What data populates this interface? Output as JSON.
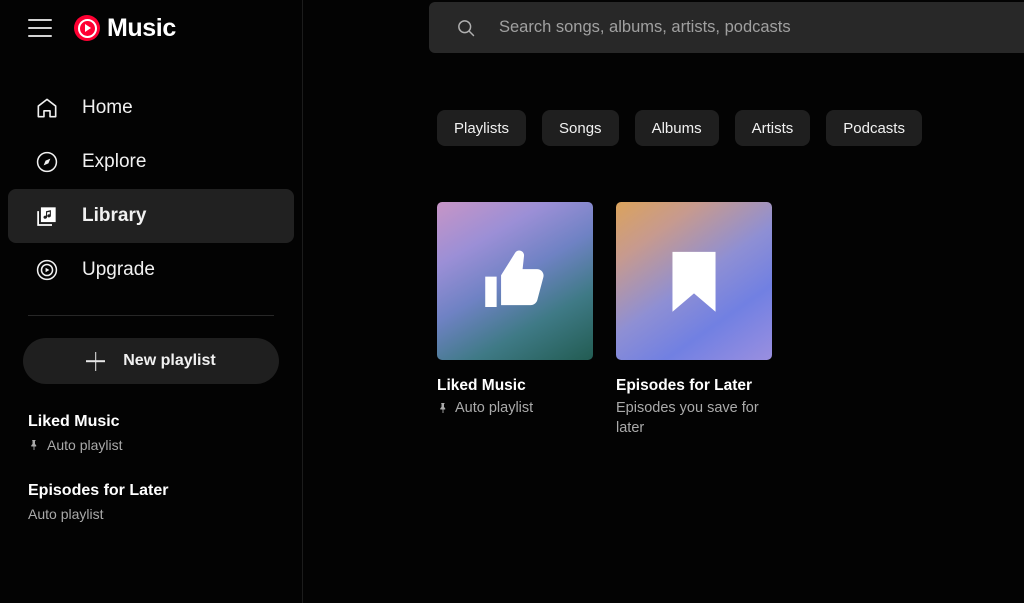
{
  "app": {
    "brand": "Music",
    "menu_icon": "hamburger-menu-icon",
    "logo_icon": "youtube-music-logo-icon"
  },
  "sidebar": {
    "nav_items": [
      {
        "label": "Home",
        "icon": "home-icon",
        "active": false
      },
      {
        "label": "Explore",
        "icon": "compass-icon",
        "active": false
      },
      {
        "label": "Library",
        "icon": "library-icon",
        "active": true
      },
      {
        "label": "Upgrade",
        "icon": "play-circle-icon",
        "active": false
      }
    ],
    "new_playlist": {
      "label": "New playlist",
      "icon": "plus-icon"
    },
    "playlists": [
      {
        "title": "Liked Music",
        "subtitle": "Auto playlist",
        "pinned": true
      },
      {
        "title": "Episodes for Later",
        "subtitle": "Auto playlist",
        "pinned": false
      }
    ]
  },
  "search": {
    "placeholder": "Search songs, albums, artists, podcasts",
    "value": "",
    "icon": "search-icon"
  },
  "main": {
    "filter_chips": [
      {
        "label": "Playlists"
      },
      {
        "label": "Songs"
      },
      {
        "label": "Albums"
      },
      {
        "label": "Artists"
      },
      {
        "label": "Podcasts"
      }
    ],
    "cards": [
      {
        "title": "Liked Music",
        "subtitle": "Auto playlist",
        "pinned": true,
        "icon": "thumbs-up-icon",
        "gradient": "linear-gradient(150deg, #c795c6 0%, #9b8fd6 26%, #6f82c4 48%, #3f7a86 72%, #225c52 100%)"
      },
      {
        "title": "Episodes for Later",
        "subtitle": "Episodes you save for later",
        "pinned": false,
        "icon": "bookmark-icon",
        "gradient": "linear-gradient(145deg, #dba35c 0%, #c79a8e 22%, #8e8fd4 50%, #7180e2 72%, #9a8fe0 100%)"
      }
    ]
  },
  "colors": {
    "brand_red": "#ff0033",
    "background": "#030303",
    "surface": "#1f1f1f",
    "active_surface": "#212121",
    "search_surface": "#282828",
    "text_primary": "#ffffff",
    "text_secondary": "#aaaaaa"
  }
}
